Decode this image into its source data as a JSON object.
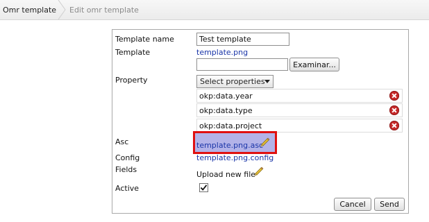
{
  "breadcrumb": {
    "items": [
      "Omr template",
      "Edit omr template"
    ]
  },
  "form": {
    "template_name": {
      "label": "Template name",
      "value": "Test template"
    },
    "template": {
      "label": "Template",
      "link": "template.png",
      "file_value": "",
      "browse_label": "Examinar..."
    },
    "property": {
      "label": "Property",
      "select_label": "Select properties",
      "items": [
        "okp:data.year",
        "okp:data.type",
        "okp:data.project"
      ]
    },
    "asc": {
      "label": "Asc",
      "link": "template.png.asc"
    },
    "config": {
      "label": "Config",
      "link": "template.png.config"
    },
    "fields": {
      "label": "Fields",
      "upload_text": "Upload new file"
    },
    "active": {
      "label": "Active",
      "checked": true
    },
    "buttons": {
      "cancel": "Cancel",
      "send": "Send"
    }
  },
  "colors": {
    "link": "#1a35a8",
    "highlight_border": "#e01010",
    "highlight_fill": "#b3b3e8",
    "remove": "#c62828"
  },
  "icons": {
    "remove": "remove-x-icon",
    "edit": "pencil-icon",
    "checkbox": "checkmark-icon"
  }
}
